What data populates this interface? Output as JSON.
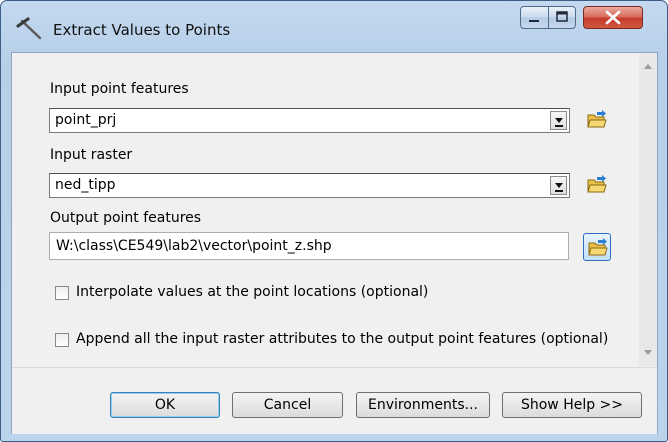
{
  "window": {
    "title": "Extract Values to Points",
    "title_icon": "hammer-tool-icon"
  },
  "form": {
    "input_point_features": {
      "label": "Input point features",
      "value": "point_prj"
    },
    "input_raster": {
      "label": "Input raster",
      "value": "ned_tipp"
    },
    "output_point_features": {
      "label": "Output point features",
      "value": "W:\\class\\CE549\\lab2\\vector\\point_z.shp"
    },
    "interpolate": {
      "label": "Interpolate values at the point locations (optional)",
      "checked": false
    },
    "append": {
      "label": "Append all the input raster attributes to the output point features (optional)",
      "checked": false
    }
  },
  "buttons": {
    "ok": "OK",
    "cancel": "Cancel",
    "environments": "Environments...",
    "show_help": "Show Help >>"
  },
  "colors": {
    "close_button": "#c43b2a",
    "folder_icon": "#e8c04a",
    "active_border": "#2b6fc2"
  }
}
